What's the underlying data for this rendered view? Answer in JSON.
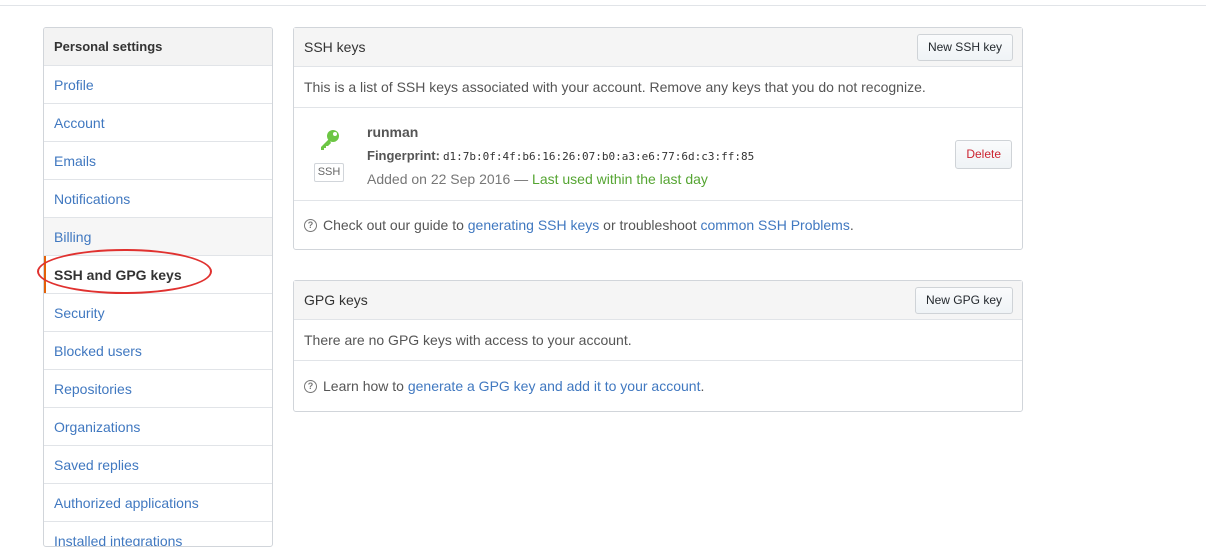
{
  "sidebar": {
    "header": "Personal settings",
    "items": [
      {
        "label": "Profile"
      },
      {
        "label": "Account"
      },
      {
        "label": "Emails"
      },
      {
        "label": "Notifications"
      },
      {
        "label": "Billing"
      },
      {
        "label": "SSH and GPG keys"
      },
      {
        "label": "Security"
      },
      {
        "label": "Blocked users"
      },
      {
        "label": "Repositories"
      },
      {
        "label": "Organizations"
      },
      {
        "label": "Saved replies"
      },
      {
        "label": "Authorized applications"
      },
      {
        "label": "Installed integrations"
      }
    ],
    "selected_index": 5
  },
  "ssh": {
    "title": "SSH keys",
    "new_button": "New SSH key",
    "description": "This is a list of SSH keys associated with your account. Remove any keys that you do not recognize.",
    "key": {
      "name": "runman",
      "fingerprint_label": "Fingerprint:",
      "fingerprint": "d1:7b:0f:4f:b6:16:26:07:b0:a3:e6:77:6d:c3:ff:85",
      "added_prefix": "Added on 22 Sep 2016 — ",
      "last_used": "Last used within the last day",
      "type_label": "SSH",
      "delete_button": "Delete",
      "icon": "key-icon",
      "icon_color": "#6cc644"
    },
    "help": {
      "prefix": "Check out our guide to ",
      "link1": "generating SSH keys",
      "middle": " or troubleshoot ",
      "link2": "common SSH Problems",
      "suffix": "."
    }
  },
  "gpg": {
    "title": "GPG keys",
    "new_button": "New GPG key",
    "description": "There are no GPG keys with access to your account.",
    "help": {
      "prefix": "Learn how to ",
      "link": "generate a GPG key and add it to your account",
      "suffix": "."
    }
  },
  "colors": {
    "link": "#4078c0",
    "selected_border": "#e36209",
    "annotation": "#e0312f",
    "delete": "#cb2431",
    "success": "#55a532"
  }
}
